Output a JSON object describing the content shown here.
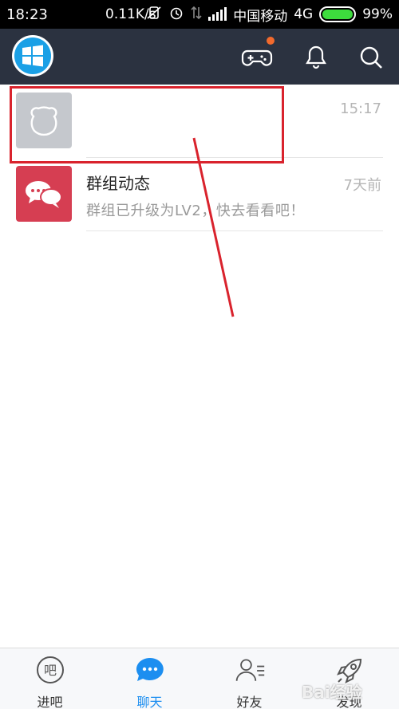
{
  "status_bar": {
    "time": "18:23",
    "speed": "0.11K/s",
    "carrier": "中国移动",
    "network": "4G",
    "battery": "99%"
  },
  "header": {
    "icons": [
      "windows-logo-icon",
      "gamepad-icon",
      "bell-icon",
      "search-icon"
    ],
    "accent": "#2b3240"
  },
  "chats": [
    {
      "name": "",
      "preview": "",
      "time": "15:17"
    },
    {
      "name": "群组动态",
      "preview": "群组已升级为LV2，快去看看吧！",
      "time": "7天前"
    }
  ],
  "nav": {
    "items": [
      {
        "label": "进吧",
        "icon": "chat-bubble-icon"
      },
      {
        "label": "聊天",
        "icon": "message-dots-icon",
        "active": true
      },
      {
        "label": "好友",
        "icon": "contacts-icon"
      },
      {
        "label": "发现",
        "icon": "rocket-icon"
      }
    ],
    "bubble_text": "吧"
  },
  "watermark": "Bai经验",
  "colors": {
    "active": "#1c8ef0",
    "highlight": "#d9232d",
    "group_avatar": "#d63e52"
  }
}
